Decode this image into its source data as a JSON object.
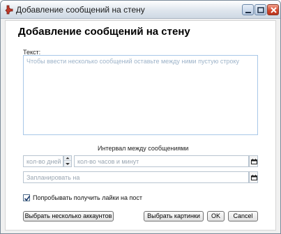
{
  "window": {
    "title": "Добавление сообщений на стену",
    "icon": "wrench-icon",
    "controls": [
      "minimize-icon",
      "maximize-icon",
      "close-icon"
    ]
  },
  "form": {
    "heading": "Добавление сообщений на стену",
    "text_label": "Текст:",
    "text_placeholder": "Чтобы ввести несколько сообщений оставьте между ними пустую строку",
    "interval_label": "Интервал между сообщениями",
    "days_placeholder": "кол-во дней",
    "hours_placeholder": "кол-во часов и минут",
    "schedule_placeholder": "Запланировать на",
    "like_checkbox": {
      "label": "Попробывать получить лайки на пост",
      "checked": true
    }
  },
  "buttons": {
    "accounts": "Выбрать несколько аккаунтов",
    "images": "Выбрать картинки",
    "ok": "OK",
    "cancel": "Cancel"
  }
}
